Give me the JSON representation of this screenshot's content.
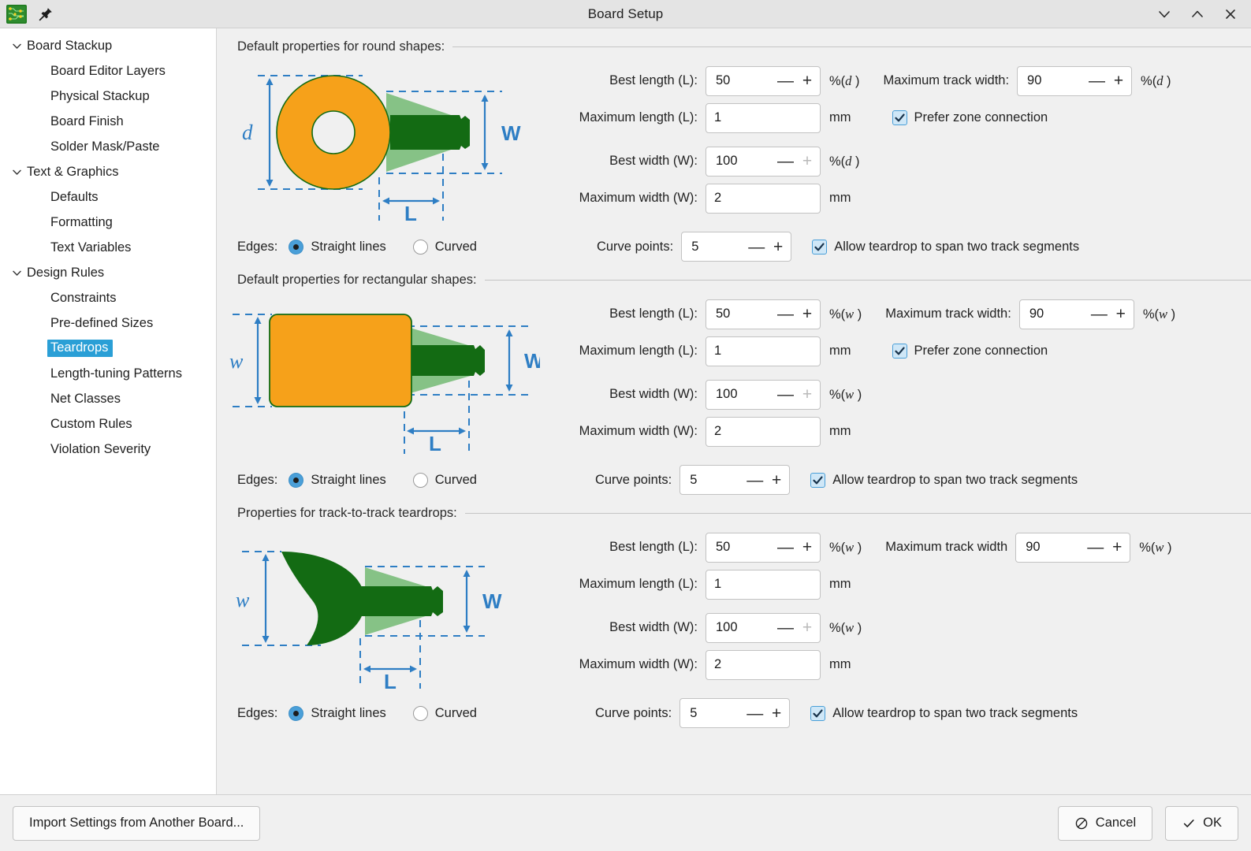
{
  "window": {
    "title": "Board Setup",
    "app_icon": "kicad-pcb-icon",
    "pin_icon": "pin-icon",
    "controls": {
      "minimize": "chevron-down-icon",
      "maximize": "chevron-up-icon",
      "close": "close-icon"
    }
  },
  "sidebar": {
    "items": [
      {
        "label": "Board Stackup",
        "level": 0,
        "expanded": true,
        "selected": false
      },
      {
        "label": "Board Editor Layers",
        "level": 1,
        "expanded": null,
        "selected": false
      },
      {
        "label": "Physical Stackup",
        "level": 1,
        "expanded": null,
        "selected": false
      },
      {
        "label": "Board Finish",
        "level": 1,
        "expanded": null,
        "selected": false
      },
      {
        "label": "Solder Mask/Paste",
        "level": 1,
        "expanded": null,
        "selected": false
      },
      {
        "label": "Text & Graphics",
        "level": 0,
        "expanded": true,
        "selected": false
      },
      {
        "label": "Defaults",
        "level": 1,
        "expanded": null,
        "selected": false
      },
      {
        "label": "Formatting",
        "level": 1,
        "expanded": null,
        "selected": false
      },
      {
        "label": "Text Variables",
        "level": 1,
        "expanded": null,
        "selected": false
      },
      {
        "label": "Design Rules",
        "level": 0,
        "expanded": true,
        "selected": false
      },
      {
        "label": "Constraints",
        "level": 1,
        "expanded": null,
        "selected": false
      },
      {
        "label": "Pre-defined Sizes",
        "level": 1,
        "expanded": null,
        "selected": false
      },
      {
        "label": "Teardrops",
        "level": 1,
        "expanded": null,
        "selected": true
      },
      {
        "label": "Length-tuning Patterns",
        "level": 1,
        "expanded": null,
        "selected": false
      },
      {
        "label": "Net Classes",
        "level": 1,
        "expanded": null,
        "selected": false
      },
      {
        "label": "Custom Rules",
        "level": 1,
        "expanded": null,
        "selected": false
      },
      {
        "label": "Violation Severity",
        "level": 1,
        "expanded": null,
        "selected": false
      }
    ]
  },
  "sections": [
    {
      "header": "Default properties for round shapes:",
      "illustration": "round-pad-teardrop-diagram",
      "diagram_labels": {
        "pad": "d",
        "track_width": "W",
        "length": "L"
      },
      "best_length_label": "Best length (L):",
      "best_length_value": "50",
      "best_length_units": "%(",
      "best_length_units_var": "d",
      "best_length_units_tail": " )",
      "best_length_plus_disabled": false,
      "max_length_label": "Maximum length (L):",
      "max_length_value": "1",
      "max_length_units": "mm",
      "best_width_label": "Best width (W):",
      "best_width_value": "100",
      "best_width_units": "%(",
      "best_width_units_var": "d",
      "best_width_units_tail": " )",
      "best_width_plus_disabled": true,
      "max_width_label": "Maximum width (W):",
      "max_width_value": "2",
      "max_width_units": "mm",
      "max_track_width_label": "Maximum track width:",
      "max_track_width_value": "90",
      "max_track_width_units": "%(",
      "max_track_width_units_var": "d",
      "max_track_width_units_tail": " )",
      "prefer_zone_shown": true,
      "prefer_zone_label": "Prefer zone connection",
      "prefer_zone_checked": true,
      "edges_label": "Edges:",
      "edges_option_straight": "Straight lines",
      "edges_option_curved": "Curved",
      "edges_selected": "Straight lines",
      "curve_points_label": "Curve points:",
      "curve_points_value": "5",
      "span_label": "Allow teardrop to span two track segments",
      "span_checked": true
    },
    {
      "header": "Default properties for rectangular shapes:",
      "illustration": "rect-pad-teardrop-diagram",
      "diagram_labels": {
        "pad": "w",
        "track_width": "W",
        "length": "L"
      },
      "best_length_label": "Best length (L):",
      "best_length_value": "50",
      "best_length_units": "%(",
      "best_length_units_var": "w",
      "best_length_units_tail": " )",
      "best_length_plus_disabled": false,
      "max_length_label": "Maximum length (L):",
      "max_length_value": "1",
      "max_length_units": "mm",
      "best_width_label": "Best width (W):",
      "best_width_value": "100",
      "best_width_units": "%(",
      "best_width_units_var": "w",
      "best_width_units_tail": " )",
      "best_width_plus_disabled": true,
      "max_width_label": "Maximum width (W):",
      "max_width_value": "2",
      "max_width_units": "mm",
      "max_track_width_label": "Maximum track width:",
      "max_track_width_value": "90",
      "max_track_width_units": "%(",
      "max_track_width_units_var": "w",
      "max_track_width_units_tail": " )",
      "prefer_zone_shown": true,
      "prefer_zone_label": "Prefer zone connection",
      "prefer_zone_checked": true,
      "edges_label": "Edges:",
      "edges_option_straight": "Straight lines",
      "edges_option_curved": "Curved",
      "edges_selected": "Straight lines",
      "curve_points_label": "Curve points:",
      "curve_points_value": "5",
      "span_label": "Allow teardrop to span two track segments",
      "span_checked": true
    },
    {
      "header": "Properties for track-to-track teardrops:",
      "illustration": "track-to-track-teardrop-diagram",
      "diagram_labels": {
        "pad": "w",
        "track_width": "W",
        "length": "L"
      },
      "best_length_label": "Best length (L):",
      "best_length_value": "50",
      "best_length_units": "%(",
      "best_length_units_var": "w",
      "best_length_units_tail": " )",
      "best_length_plus_disabled": false,
      "max_length_label": "Maximum length (L):",
      "max_length_value": "1",
      "max_length_units": "mm",
      "best_width_label": "Best width (W):",
      "best_width_value": "100",
      "best_width_units": "%(",
      "best_width_units_var": "w",
      "best_width_units_tail": " )",
      "best_width_plus_disabled": true,
      "max_width_label": "Maximum width (W):",
      "max_width_value": "2",
      "max_width_units": "mm",
      "max_track_width_label": "Maximum track width",
      "max_track_width_value": "90",
      "max_track_width_units": "%(",
      "max_track_width_units_var": "w",
      "max_track_width_units_tail": " )",
      "prefer_zone_shown": false,
      "prefer_zone_label": "",
      "prefer_zone_checked": false,
      "edges_label": "Edges:",
      "edges_option_straight": "Straight lines",
      "edges_option_curved": "Curved",
      "edges_selected": "Straight lines",
      "curve_points_label": "Curve points:",
      "curve_points_value": "5",
      "span_label": "Allow teardrop to span two track segments",
      "span_checked": true
    }
  ],
  "spinner": {
    "minus": "—",
    "plus": "+"
  },
  "footer": {
    "import_label": "Import Settings from Another Board...",
    "cancel_label": "Cancel",
    "cancel_icon": "no-entry-icon",
    "ok_label": "OK",
    "ok_icon": "check-icon"
  },
  "colors": {
    "accent": "#2a9fd6",
    "pad_orange": "#F6A11A",
    "track_green": "#136B13",
    "teardrop_green": "#7FBF7F",
    "dimension_blue": "#2E7EC4",
    "window_bg": "#f0f0f0",
    "sidebar_bg": "#ffffff"
  }
}
